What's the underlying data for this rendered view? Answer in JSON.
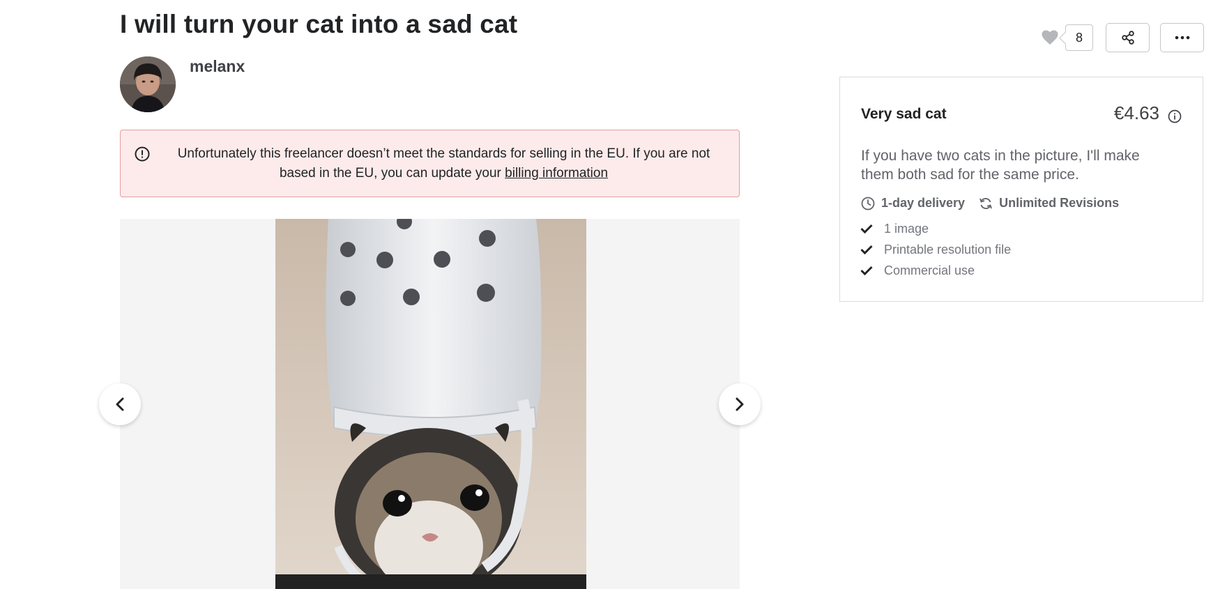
{
  "gig": {
    "title": "I will turn your cat into a sad cat"
  },
  "seller": {
    "name": "melanx"
  },
  "alert": {
    "message": "Unfortunately this freelancer doesn’t meet the standards for selling in the EU. If you are not based in the EU, you can update your",
    "link_text": "billing information"
  },
  "actions": {
    "like_count": "8",
    "heart_icon": "heart-icon",
    "share_icon": "share-icon",
    "more_icon": "more-icon"
  },
  "gallery": {
    "prev_icon": "chevron-left-icon",
    "next_icon": "chevron-right-icon"
  },
  "package": {
    "name": "Very sad cat",
    "price": "€4.63",
    "description": "If you have two cats in the picture, I'll make them both sad for the same price.",
    "delivery": "1-day delivery",
    "revisions": "Unlimited Revisions",
    "features": [
      "1 image",
      "Printable resolution file",
      "Commercial use"
    ]
  },
  "colors": {
    "alert_bg": "#fdebeb",
    "alert_border": "#e59da0",
    "text_primary": "#222325",
    "text_secondary": "#62646a",
    "heart_gray": "#b5b6ba"
  }
}
